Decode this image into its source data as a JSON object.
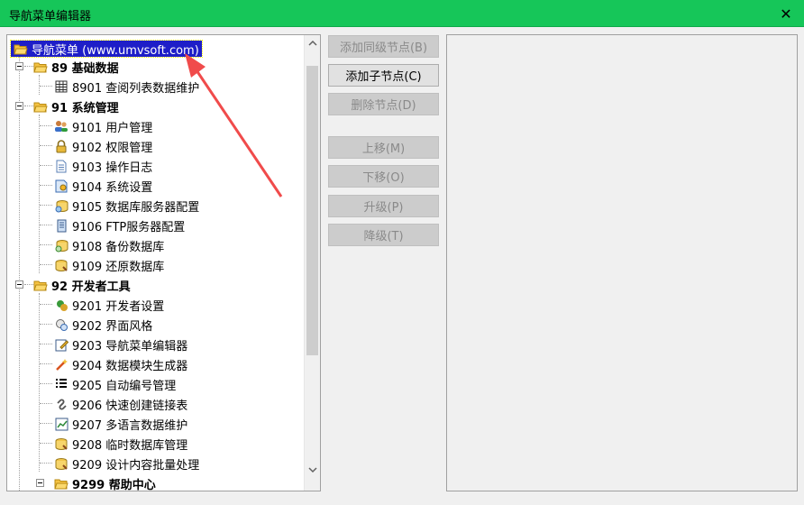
{
  "window": {
    "title": "导航菜单编辑器",
    "close_label": "✕"
  },
  "tree": {
    "root": {
      "label": "导航菜单 (www.umvsoft.com)"
    },
    "groups": [
      {
        "id": "89",
        "label": "89 基础数据",
        "items": [
          {
            "label": "8901 查阅列表数据维护",
            "icon": "grid-icon"
          }
        ]
      },
      {
        "id": "91",
        "label": "91 系统管理",
        "items": [
          {
            "label": "9101 用户管理",
            "icon": "users-icon"
          },
          {
            "label": "9102 权限管理",
            "icon": "lock-icon"
          },
          {
            "label": "9103 操作日志",
            "icon": "document-icon"
          },
          {
            "label": "9104 系统设置",
            "icon": "settings-doc-icon"
          },
          {
            "label": "9105 数据库服务器配置",
            "icon": "db-server-icon"
          },
          {
            "label": "9106 FTP服务器配置",
            "icon": "ftp-server-icon"
          },
          {
            "label": "9108 备份数据库",
            "icon": "backup-db-icon"
          },
          {
            "label": "9109 还原数据库",
            "icon": "restore-db-icon"
          }
        ]
      },
      {
        "id": "92",
        "label": "92 开发者工具",
        "items": [
          {
            "label": "9201 开发者设置",
            "icon": "developer-icon"
          },
          {
            "label": "9202 界面风格",
            "icon": "style-icon"
          },
          {
            "label": "9203 导航菜单编辑器",
            "icon": "edit-doc-icon"
          },
          {
            "label": "9204 数据模块生成器",
            "icon": "wand-icon"
          },
          {
            "label": "9205 自动编号管理",
            "icon": "numbered-list-icon"
          },
          {
            "label": "9206 快速创建链接表",
            "icon": "link-icon"
          },
          {
            "label": "9207 多语言数据维护",
            "icon": "chart-icon"
          },
          {
            "label": "9208 临时数据库管理",
            "icon": "temp-db-icon"
          },
          {
            "label": "9209 设计内容批量处理",
            "icon": "batch-db-icon"
          }
        ]
      },
      {
        "id": "9299",
        "label": "9299 帮助中心",
        "items": []
      }
    ]
  },
  "buttons": {
    "add_sibling": "添加同级节点(B)",
    "add_child": "添加子节点(C)",
    "delete": "删除节点(D)",
    "move_up": "上移(M)",
    "move_down": "下移(O)",
    "promote": "升级(P)",
    "demote": "降级(T)"
  },
  "colors": {
    "titlebar": "#16c659",
    "selection": "#1e1ec8",
    "folder": "#f5c242",
    "annotation_arrow": "#f04b4b"
  }
}
